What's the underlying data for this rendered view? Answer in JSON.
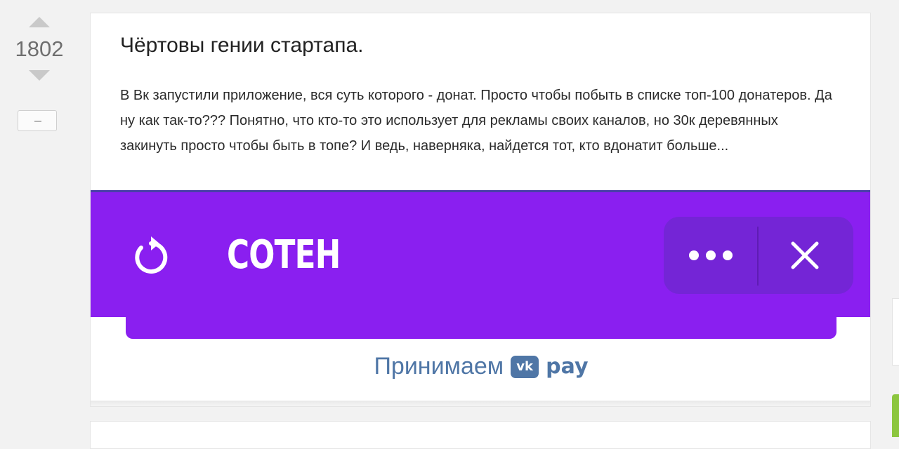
{
  "vote": {
    "count": "1802"
  },
  "post": {
    "title": "Чёртовы гении стартапа.",
    "body": "В Вк запустили приложение, вся суть которого - донат. Просто чтобы побыть в списке топ-100 донатеров. Да ну как так-то??? Понятно, что кто-то это использует для рекламы своих каналов, но 30к деревянных закинуть просто чтобы быть в топе? И ведь, наверняка, найдется тот, кто вдонатит больше...",
    "image": {
      "app_name": "СОТЕН",
      "pay_label": "Принимаем",
      "pay_logo_text": "vk",
      "pay_word": "pay",
      "icons": [
        "refresh-icon",
        "more-icon",
        "close-icon"
      ],
      "colors": {
        "header": "#8a1ff0",
        "pill": "#7425d6",
        "pay_blue": "#4f76a6"
      }
    }
  },
  "colors": {
    "page_bg": "#f2f2f2",
    "card_bg": "#ffffff",
    "green_accent": "#8cc63f"
  }
}
